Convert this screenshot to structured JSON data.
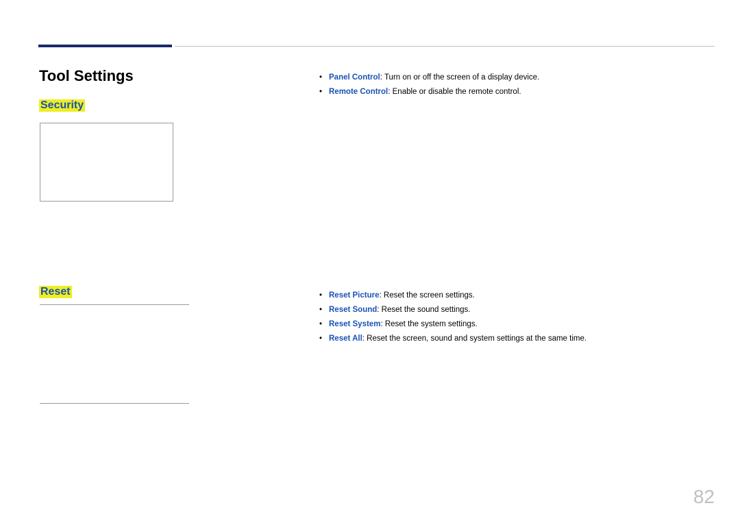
{
  "page_title": "Tool Settings",
  "section_security": "Security",
  "section_reset": "Reset",
  "bullets_top": [
    {
      "label": "Panel Control",
      "text": ": Turn on or off the screen of a display device."
    },
    {
      "label": "Remote Control",
      "text": ": Enable or disable the remote control."
    }
  ],
  "bullets_bottom": [
    {
      "label": "Reset Picture",
      "text": ": Reset the screen settings."
    },
    {
      "label": "Reset Sound",
      "text": ": Reset the sound settings."
    },
    {
      "label": "Reset System",
      "text": ": Reset the system settings."
    },
    {
      "label": "Reset All",
      "text": ": Reset the screen, sound and system settings at the same time."
    }
  ],
  "page_number": "82",
  "bullet_glyph": "•"
}
